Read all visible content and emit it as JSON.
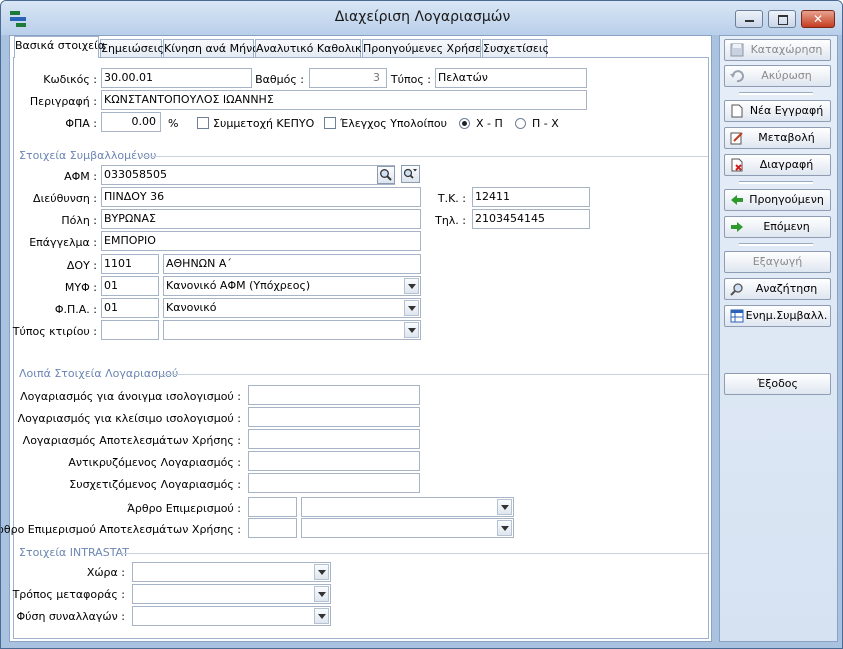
{
  "window": {
    "title": "Διαχείριση Λογαριασμών"
  },
  "tabs": [
    "Βασικά στοιχεία",
    "Σημειώσεις",
    "Κίνηση ανά Μήνα",
    "Αναλυτικό Καθολικό",
    "Προηγούμενες Χρήσεις",
    "Συσχετίσεις"
  ],
  "basic": {
    "code_label": "Κωδικός :",
    "code_value": "30.00.01",
    "level_label": "Βαθμός :",
    "level_value": "3",
    "type_label": "Τύπος :",
    "type_value": "Πελατών",
    "desc_label": "Περιγραφή :",
    "desc_value": "ΚΩΝΣΤΑΝΤΟΠΟΥΛΟΣ ΙΩΑΝΝΗΣ",
    "vat_label": "ΦΠΑ :",
    "vat_value": "0.00",
    "vat_unit": "%",
    "kepyo_label": "Συμμετοχή ΚΕΠΥΟ",
    "balance_label": "Έλεγχος Υπολοίπου",
    "radio1_label": "Χ - Π",
    "radio2_label": "Π - Χ"
  },
  "contractor": {
    "section": "Στοιχεία Συμβαλλομένου",
    "afm_label": "ΑΦΜ :",
    "afm_value": "033058505",
    "address_label": "Διεύθυνση :",
    "address_value": "ΠΙΝΔΟΥ 36",
    "tk_label": "Τ.Κ. :",
    "tk_value": "12411",
    "city_label": "Πόλη :",
    "city_value": "ΒΥΡΩΝΑΣ",
    "phone_label": "Τηλ. :",
    "phone_value": "2103454145",
    "job_label": "Επάγγελμα :",
    "job_value": "ΕΜΠΟΡΙΟ",
    "doy_label": "ΔΟΥ :",
    "doy_code": "1101",
    "doy_name": "ΑΘΗΝΩΝ Α΄",
    "myf_label": "ΜΥΦ :",
    "myf_code": "01",
    "myf_name": "Κανονικό ΑΦΜ (Υπόχρεος)",
    "fpa_label": "Φ.Π.Α. :",
    "fpa_code": "01",
    "fpa_name": "Κανονικό",
    "building_label": "Τύπος κτιρίου :"
  },
  "other": {
    "section": "Λοιπά Στοιχεία Λογαριασμού",
    "open_label": "Λογαριασμός για άνοιγμα ισολογισμού :",
    "close_label": "Λογαριασμός για κλείσιμο ισολογισμού :",
    "results_label": "Λογαριασμός Αποτελεσμάτων Χρήσης :",
    "offset_label": "Αντικρυζόμενος Λογαριασμός :",
    "related_label": "Συσχετιζόμενος Λογαριασμός :",
    "alloc_label": "Άρθρο Επιμερισμού :",
    "alloc_results_label": "Άρθρο Επιμερισμού Αποτελεσμάτων Χρήσης :"
  },
  "intrastat": {
    "section": "Στοιχεία INTRASTAT",
    "country_label": "Χώρα :",
    "transport_label": "Τρόπος μεταφοράς :",
    "nature_label": "Φύση συναλλαγών :"
  },
  "side": {
    "save": "Καταχώρηση",
    "cancel": "Ακύρωση",
    "new": "Νέα Εγγραφή",
    "edit": "Μεταβολή",
    "delete": "Διαγραφή",
    "prev": "Προηγούμενη",
    "next": "Επόμενη",
    "export": "Εξαγωγή",
    "search": "Αναζήτηση",
    "update": "Ενημ.Συμβαλλ.",
    "exit": "Έξοδος"
  },
  "colors": {
    "section": "#6b86b3",
    "window_frame": "#a9c2e0"
  }
}
